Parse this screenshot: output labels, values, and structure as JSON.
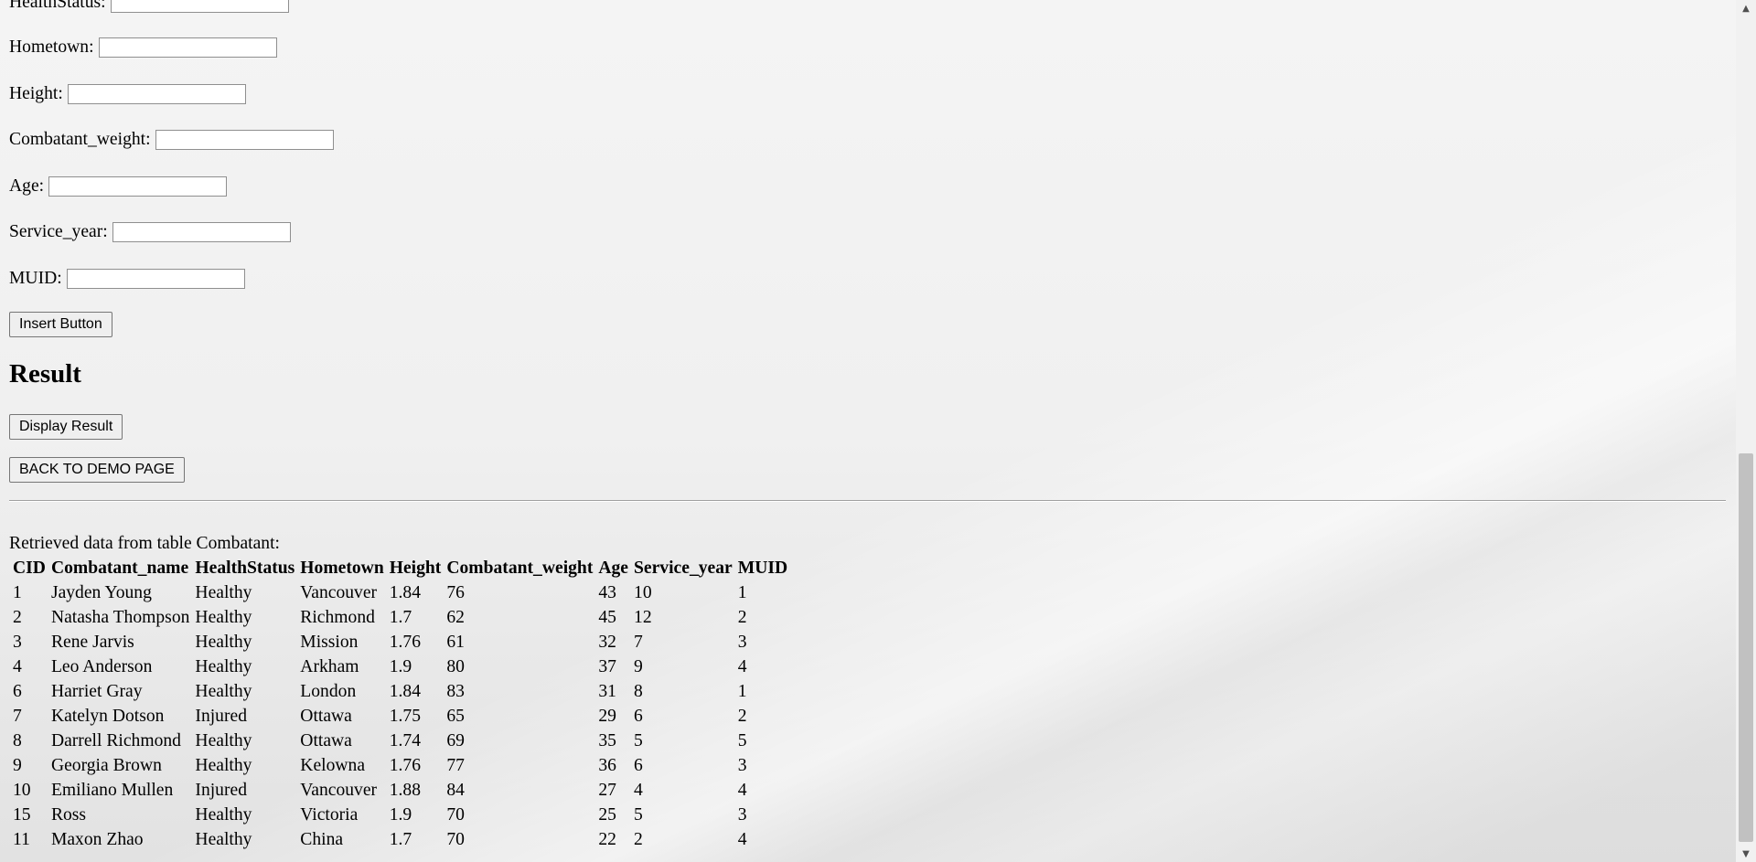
{
  "form": {
    "fields": [
      {
        "label": "HealthStatus:",
        "value": ""
      },
      {
        "label": "Hometown:",
        "value": ""
      },
      {
        "label": "Height:",
        "value": ""
      },
      {
        "label": "Combatant_weight:",
        "value": ""
      },
      {
        "label": "Age:",
        "value": ""
      },
      {
        "label": "Service_year:",
        "value": ""
      },
      {
        "label": "MUID:",
        "value": ""
      }
    ],
    "insert_button": "Insert Button"
  },
  "result": {
    "heading": "Result",
    "display_button": "Display Result",
    "back_button": "BACK TO DEMO PAGE",
    "retrieved_text": "Retrieved data from table Combatant:"
  },
  "table": {
    "headers": [
      "CID",
      "Combatant_name",
      "HealthStatus",
      "Hometown",
      "Height",
      "Combatant_weight",
      "Age",
      "Service_year",
      "MUID"
    ],
    "rows": [
      [
        "1",
        "Jayden Young",
        "Healthy",
        "Vancouver",
        "1.84",
        "76",
        "43",
        "10",
        "1"
      ],
      [
        "2",
        "Natasha Thompson",
        "Healthy",
        "Richmond",
        "1.7",
        "62",
        "45",
        "12",
        "2"
      ],
      [
        "3",
        "Rene Jarvis",
        "Healthy",
        "Mission",
        "1.76",
        "61",
        "32",
        "7",
        "3"
      ],
      [
        "4",
        "Leo Anderson",
        "Healthy",
        "Arkham",
        "1.9",
        "80",
        "37",
        "9",
        "4"
      ],
      [
        "6",
        "Harriet Gray",
        "Healthy",
        "London",
        "1.84",
        "83",
        "31",
        "8",
        "1"
      ],
      [
        "7",
        "Katelyn Dotson",
        "Injured",
        "Ottawa",
        "1.75",
        "65",
        "29",
        "6",
        "2"
      ],
      [
        "8",
        "Darrell Richmond",
        "Healthy",
        "Ottawa",
        "1.74",
        "69",
        "35",
        "5",
        "5"
      ],
      [
        "9",
        "Georgia Brown",
        "Healthy",
        "Kelowna",
        "1.76",
        "77",
        "36",
        "6",
        "3"
      ],
      [
        "10",
        "Emiliano Mullen",
        "Injured",
        "Vancouver",
        "1.88",
        "84",
        "27",
        "4",
        "4"
      ],
      [
        "15",
        "Ross",
        "Healthy",
        "Victoria",
        "1.9",
        "70",
        "25",
        "5",
        "3"
      ],
      [
        "11",
        "Maxon Zhao",
        "Healthy",
        "China",
        "1.7",
        "70",
        "22",
        "2",
        "4"
      ]
    ]
  },
  "scrollbar": {
    "up_icon": "triangle-up-icon",
    "down_icon": "triangle-down-icon"
  }
}
